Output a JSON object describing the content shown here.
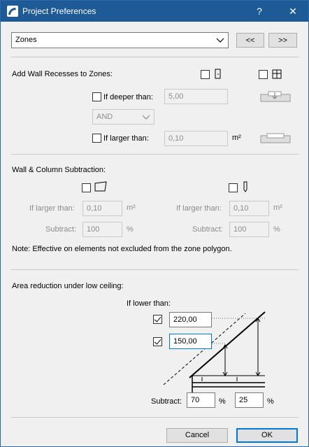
{
  "window": {
    "title": "Project Preferences",
    "help_label": "?",
    "close_label": "✕"
  },
  "top": {
    "category": "Zones",
    "prev_label": "<<",
    "next_label": ">>"
  },
  "recesses": {
    "heading": "Add Wall Recesses to Zones:",
    "deeper_label": "If deeper than:",
    "deeper_value": "5,00",
    "operator": "AND",
    "larger_label": "If larger than:",
    "larger_value": "0,10",
    "larger_unit": "m²"
  },
  "subtraction": {
    "heading": "Wall & Column Subtraction:",
    "left": {
      "larger_label": "If larger than:",
      "larger_value": "0,10",
      "larger_unit": "m²",
      "subtract_label": "Subtract:",
      "subtract_value": "100",
      "subtract_unit": "%"
    },
    "right": {
      "larger_label": "If larger than:",
      "larger_value": "0,10",
      "larger_unit": "m²",
      "subtract_label": "Subtract:",
      "subtract_value": "100",
      "subtract_unit": "%"
    },
    "note": "Note: Effective on elements not excluded from the zone polygon."
  },
  "ceiling": {
    "heading": "Area reduction under low ceiling:",
    "lower_label": "If lower than:",
    "height1": "220,00",
    "height2": "150,00",
    "subtract_label": "Subtract:",
    "subtract1": "70",
    "subtract1_unit": "%",
    "subtract2": "25",
    "subtract2_unit": "%"
  },
  "footer": {
    "cancel_label": "Cancel",
    "ok_label": "OK"
  }
}
